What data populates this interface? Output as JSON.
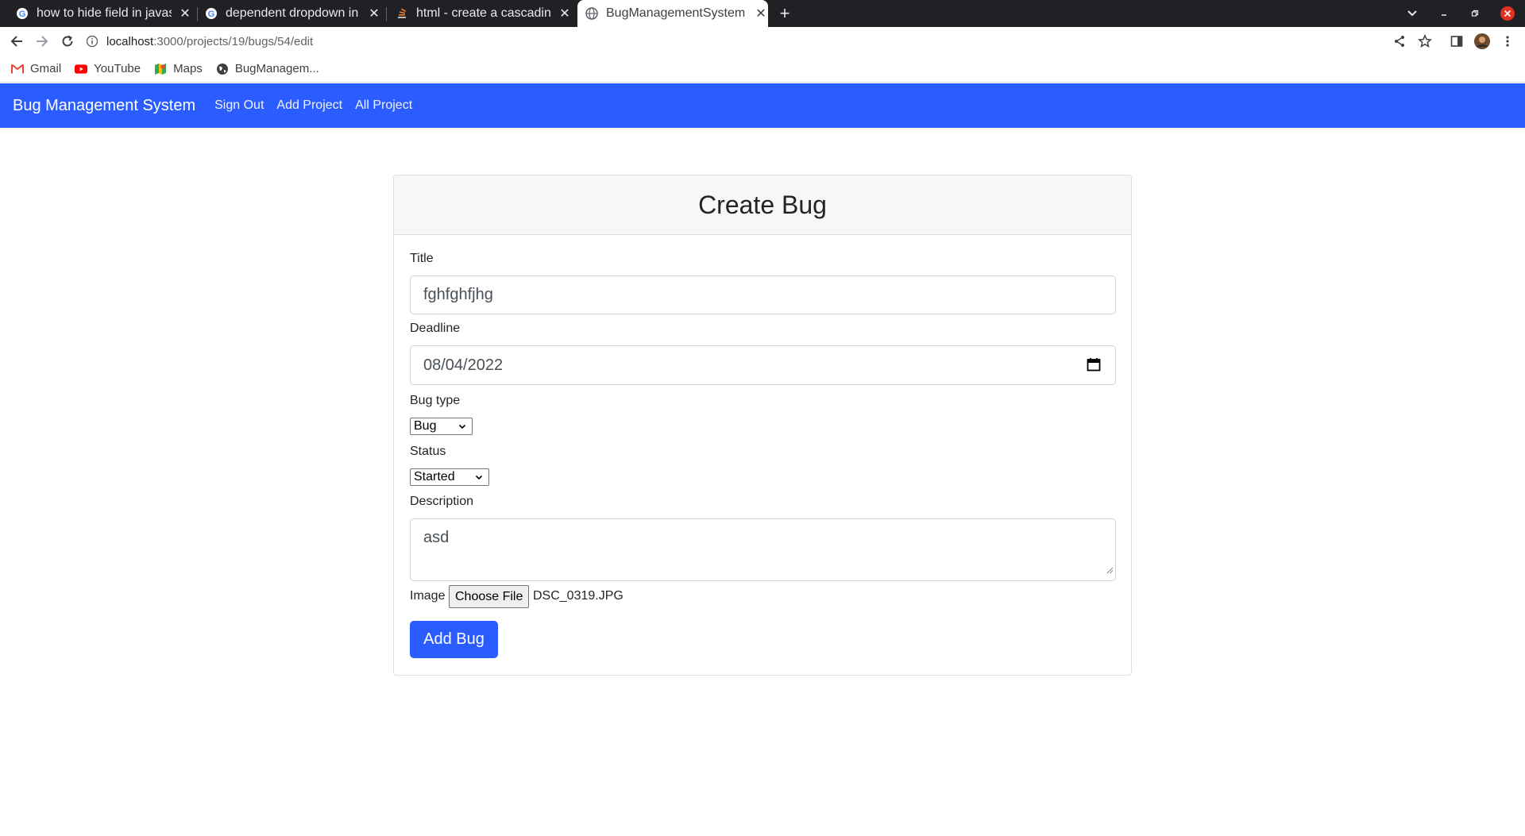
{
  "browser": {
    "tabs": [
      {
        "title": "how to hide field in javascript",
        "icon": "google-icon"
      },
      {
        "title": "dependent dropdown in javascript",
        "icon": "google-icon"
      },
      {
        "title": "html - create a cascading dropdown",
        "icon": "stackoverflow-icon"
      },
      {
        "title": "BugManagementSystem",
        "icon": "globe-icon",
        "active": true
      }
    ],
    "url_host": "localhost",
    "url_path": ":3000/projects/19/bugs/54/edit",
    "bookmarks": [
      {
        "label": "Gmail",
        "icon": "gmail-icon"
      },
      {
        "label": "YouTube",
        "icon": "youtube-icon"
      },
      {
        "label": "Maps",
        "icon": "maps-icon"
      },
      {
        "label": "BugManagem...",
        "icon": "globe-icon"
      }
    ]
  },
  "nav": {
    "brand": "Bug Management System",
    "links": [
      "Sign Out",
      "Add Project",
      "All Project"
    ],
    "color": "#2a5cff"
  },
  "form": {
    "heading": "Create Bug",
    "title_label": "Title",
    "title_value": "fghfghfjhg",
    "deadline_label": "Deadline",
    "deadline_value": "08/04/2022",
    "bug_type_label": "Bug type",
    "bug_type_value": "Bug",
    "status_label": "Status",
    "status_value": "Started",
    "description_label": "Description",
    "description_value": "asd",
    "image_label": "Image",
    "choose_file_label": "Choose File",
    "file_name": "DSC_0319.JPG",
    "submit_label": "Add Bug"
  }
}
